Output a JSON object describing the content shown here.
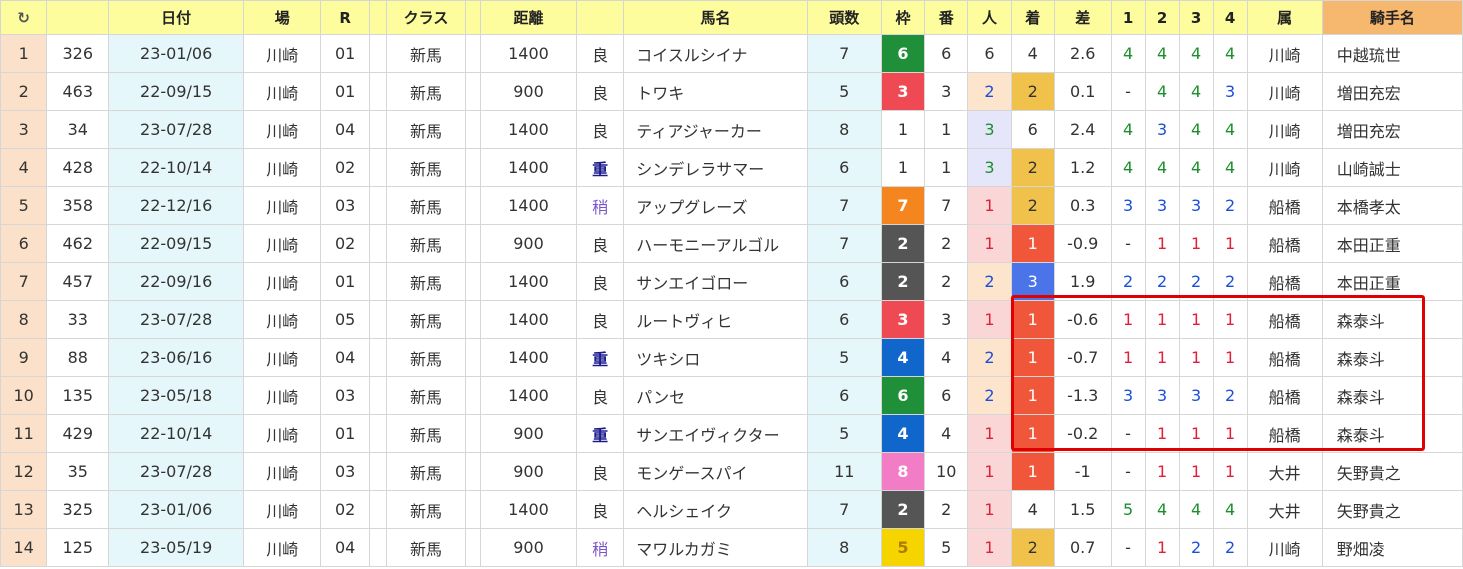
{
  "header": {
    "refresh_icon": "↻",
    "columns": [
      "日付",
      "場",
      "R",
      "",
      "クラス",
      "",
      "距離",
      "",
      "馬名",
      "頭数",
      "枠",
      "番",
      "人",
      "着",
      "差",
      "1",
      "2",
      "3",
      "4",
      "属",
      "騎手名"
    ]
  },
  "colors": {
    "header_bg": "#fdfd9e",
    "jockey_header_bg": "#f6b76e",
    "rownum_bg": "#fbe1c9",
    "date_bg": "#e6f7fb",
    "waku": {
      "1": "#ffffff",
      "2": "#555555",
      "3": "#ef4a54",
      "4": "#1166cc",
      "5": "#f5d400",
      "6": "#1f8f3a",
      "7": "#f5851f",
      "8": "#f27cc5"
    },
    "finish_1": "#f0573a",
    "finish_2": "#f0c14b",
    "finish_3": "#4a74e8",
    "pop_red_bg": "#fbd6d6",
    "pop_blue_bg": "#e6e6fa",
    "pop_peach_bg": "#fde4cc",
    "highlight_border": "#e00000"
  },
  "rows": [
    {
      "no": "1",
      "id": "326",
      "date": "23-01/06",
      "venue": "川崎",
      "race": "01",
      "cls": "新馬",
      "dist": "1400",
      "cond": "良",
      "name": "コイスルシイナ",
      "heads": "7",
      "waku": "6",
      "ban": "6",
      "pop": "6",
      "fin": "4",
      "diff": "2.6",
      "p1": "4",
      "p2": "4",
      "p3": "4",
      "p4": "4",
      "aff": "川崎",
      "jockey": "中越琉世"
    },
    {
      "no": "2",
      "id": "463",
      "date": "22-09/15",
      "venue": "川崎",
      "race": "01",
      "cls": "新馬",
      "dist": "900",
      "cond": "良",
      "name": "トワキ",
      "heads": "5",
      "waku": "3",
      "ban": "3",
      "pop": "2",
      "fin": "2",
      "diff": "0.1",
      "p1": "-",
      "p2": "4",
      "p3": "4",
      "p4": "3",
      "aff": "川崎",
      "jockey": "増田充宏"
    },
    {
      "no": "3",
      "id": "34",
      "date": "23-07/28",
      "venue": "川崎",
      "race": "04",
      "cls": "新馬",
      "dist": "1400",
      "cond": "良",
      "name": "ティアジャーカー",
      "heads": "8",
      "waku": "1",
      "ban": "1",
      "pop": "3",
      "fin": "6",
      "diff": "2.4",
      "p1": "4",
      "p2": "3",
      "p3": "4",
      "p4": "4",
      "aff": "川崎",
      "jockey": "増田充宏"
    },
    {
      "no": "4",
      "id": "428",
      "date": "22-10/14",
      "venue": "川崎",
      "race": "02",
      "cls": "新馬",
      "dist": "1400",
      "cond": "重",
      "name": "シンデレラサマー",
      "heads": "6",
      "waku": "1",
      "ban": "1",
      "pop": "3",
      "fin": "2",
      "diff": "1.2",
      "p1": "4",
      "p2": "4",
      "p3": "4",
      "p4": "4",
      "aff": "川崎",
      "jockey": "山崎誠士"
    },
    {
      "no": "5",
      "id": "358",
      "date": "22-12/16",
      "venue": "川崎",
      "race": "03",
      "cls": "新馬",
      "dist": "1400",
      "cond": "稍",
      "name": "アップグレーズ",
      "heads": "7",
      "waku": "7",
      "ban": "7",
      "pop": "1",
      "fin": "2",
      "diff": "0.3",
      "p1": "3",
      "p2": "3",
      "p3": "3",
      "p4": "2",
      "aff": "船橋",
      "jockey": "本橋孝太"
    },
    {
      "no": "6",
      "id": "462",
      "date": "22-09/15",
      "venue": "川崎",
      "race": "02",
      "cls": "新馬",
      "dist": "900",
      "cond": "良",
      "name": "ハーモニーアルゴル",
      "heads": "7",
      "waku": "2",
      "ban": "2",
      "pop": "1",
      "fin": "1",
      "diff": "-0.9",
      "p1": "-",
      "p2": "1",
      "p3": "1",
      "p4": "1",
      "aff": "船橋",
      "jockey": "本田正重"
    },
    {
      "no": "7",
      "id": "457",
      "date": "22-09/16",
      "venue": "川崎",
      "race": "01",
      "cls": "新馬",
      "dist": "1400",
      "cond": "良",
      "name": "サンエイゴロー",
      "heads": "6",
      "waku": "2",
      "ban": "2",
      "pop": "2",
      "fin": "3",
      "diff": "1.9",
      "p1": "2",
      "p2": "2",
      "p3": "2",
      "p4": "2",
      "aff": "船橋",
      "jockey": "本田正重"
    },
    {
      "no": "8",
      "id": "33",
      "date": "23-07/28",
      "venue": "川崎",
      "race": "05",
      "cls": "新馬",
      "dist": "1400",
      "cond": "良",
      "name": "ルートヴィヒ",
      "heads": "6",
      "waku": "3",
      "ban": "3",
      "pop": "1",
      "fin": "1",
      "diff": "-0.6",
      "p1": "1",
      "p2": "1",
      "p3": "1",
      "p4": "1",
      "aff": "船橋",
      "jockey": "森泰斗"
    },
    {
      "no": "9",
      "id": "88",
      "date": "23-06/16",
      "venue": "川崎",
      "race": "04",
      "cls": "新馬",
      "dist": "1400",
      "cond": "重",
      "name": "ツキシロ",
      "heads": "5",
      "waku": "4",
      "ban": "4",
      "pop": "2",
      "fin": "1",
      "diff": "-0.7",
      "p1": "1",
      "p2": "1",
      "p3": "1",
      "p4": "1",
      "aff": "船橋",
      "jockey": "森泰斗"
    },
    {
      "no": "10",
      "id": "135",
      "date": "23-05/18",
      "venue": "川崎",
      "race": "03",
      "cls": "新馬",
      "dist": "1400",
      "cond": "良",
      "name": "パンセ",
      "heads": "6",
      "waku": "6",
      "ban": "6",
      "pop": "2",
      "fin": "1",
      "diff": "-1.3",
      "p1": "3",
      "p2": "3",
      "p3": "3",
      "p4": "2",
      "aff": "船橋",
      "jockey": "森泰斗"
    },
    {
      "no": "11",
      "id": "429",
      "date": "22-10/14",
      "venue": "川崎",
      "race": "01",
      "cls": "新馬",
      "dist": "900",
      "cond": "重",
      "name": "サンエイヴィクター",
      "heads": "5",
      "waku": "4",
      "ban": "4",
      "pop": "1",
      "fin": "1",
      "diff": "-0.2",
      "p1": "-",
      "p2": "1",
      "p3": "1",
      "p4": "1",
      "aff": "船橋",
      "jockey": "森泰斗"
    },
    {
      "no": "12",
      "id": "35",
      "date": "23-07/28",
      "venue": "川崎",
      "race": "03",
      "cls": "新馬",
      "dist": "900",
      "cond": "良",
      "name": "モンゲースパイ",
      "heads": "11",
      "waku": "8",
      "ban": "10",
      "pop": "1",
      "fin": "1",
      "diff": "-1",
      "p1": "-",
      "p2": "1",
      "p3": "1",
      "p4": "1",
      "aff": "大井",
      "jockey": "矢野貴之"
    },
    {
      "no": "13",
      "id": "325",
      "date": "23-01/06",
      "venue": "川崎",
      "race": "02",
      "cls": "新馬",
      "dist": "1400",
      "cond": "良",
      "name": "ヘルシェイク",
      "heads": "7",
      "waku": "2",
      "ban": "2",
      "pop": "1",
      "fin": "4",
      "diff": "1.5",
      "p1": "5",
      "p2": "4",
      "p3": "4",
      "p4": "4",
      "aff": "大井",
      "jockey": "矢野貴之"
    },
    {
      "no": "14",
      "id": "125",
      "date": "23-05/19",
      "venue": "川崎",
      "race": "04",
      "cls": "新馬",
      "dist": "900",
      "cond": "稍",
      "name": "マワルカガミ",
      "heads": "8",
      "waku": "5",
      "ban": "5",
      "pop": "1",
      "fin": "2",
      "diff": "0.7",
      "p1": "-",
      "p2": "1",
      "p3": "2",
      "p4": "2",
      "aff": "川崎",
      "jockey": "野畑凌"
    }
  ]
}
